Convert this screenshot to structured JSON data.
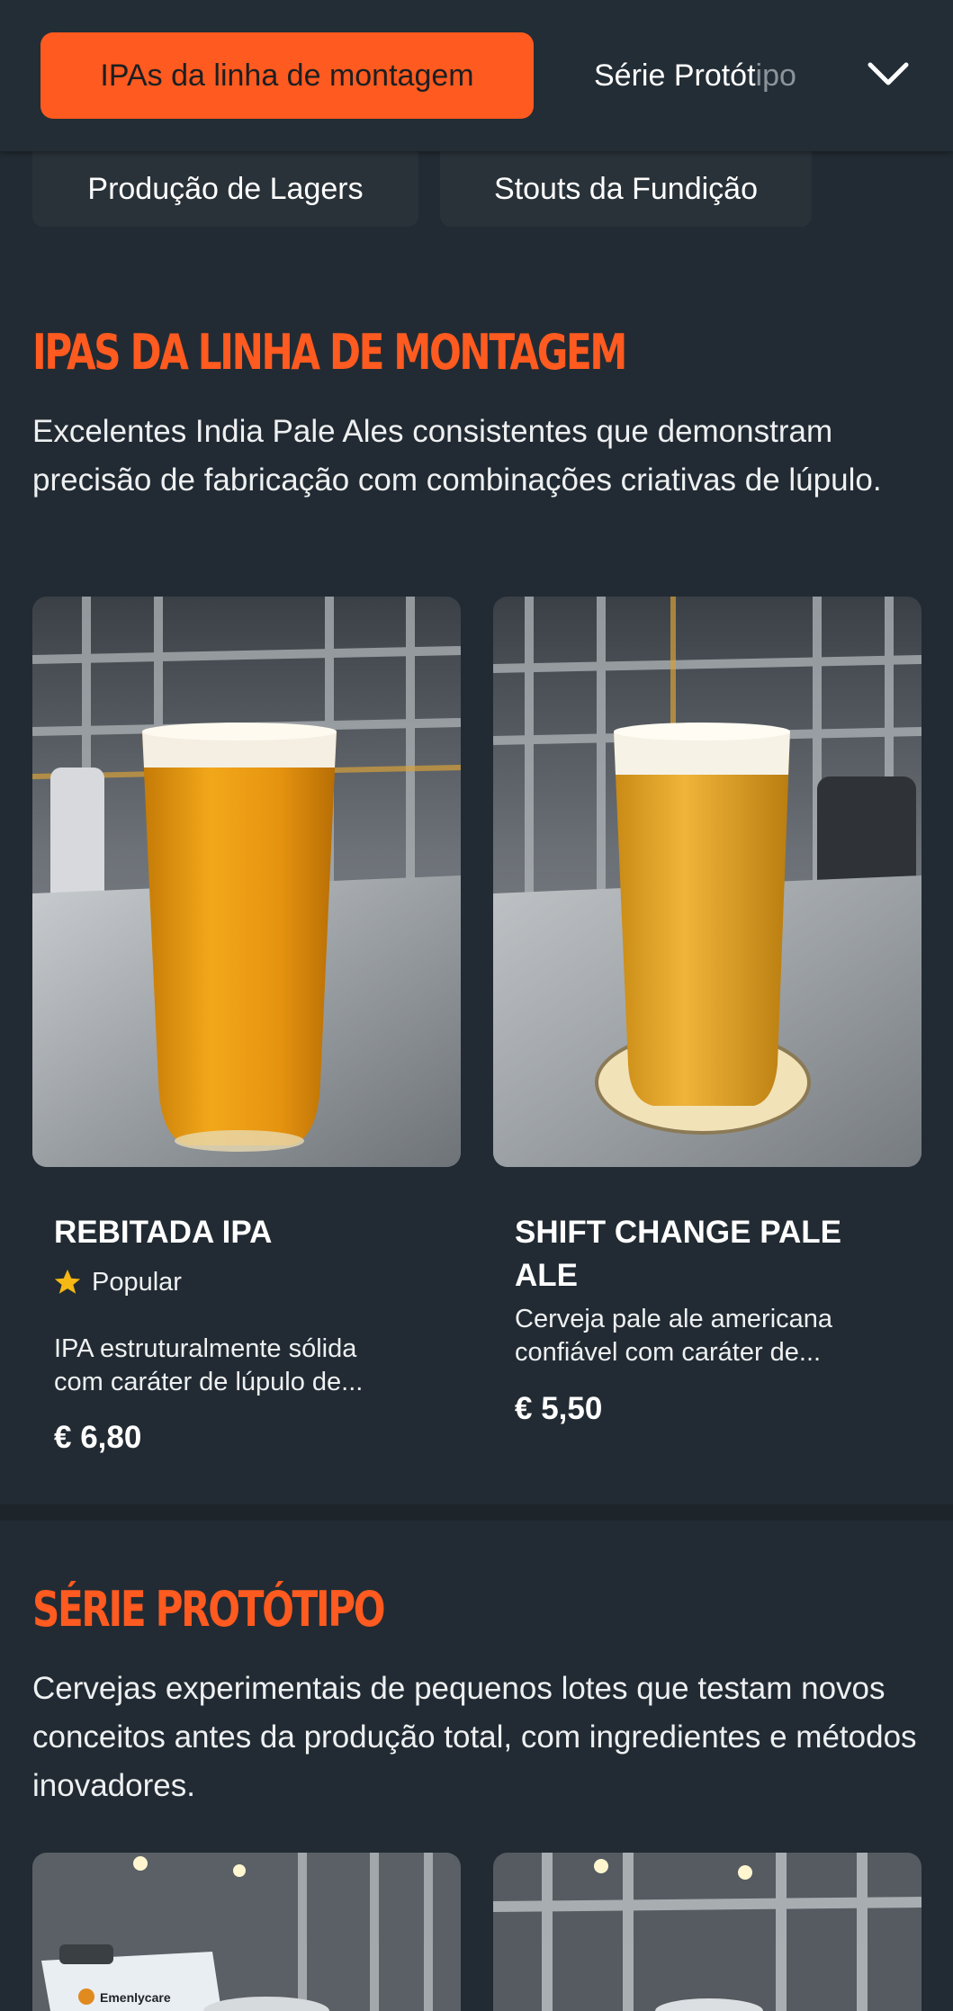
{
  "nav": {
    "active_tab": "IPAs da linha de montagem",
    "next_tab_visible": "Série Protót",
    "next_tab_faded": "ipo",
    "subtabs": [
      "Produção de Lagers",
      "Stouts da Fundição"
    ]
  },
  "sections": [
    {
      "title": "IPAs da linha de montagem",
      "description": "Excelentes India Pale Ales consistentes que demonstram precisão de fabricação com combinações criativas de lúpulo.",
      "products": [
        {
          "name": "REBITADA IPA",
          "badge": "Popular",
          "description_line1": "IPA estruturalmente sólida",
          "description_line2": "com caráter de lúpulo de...",
          "price": "€ 6,80"
        },
        {
          "name_line1": "SHIFT CHANGE PALE",
          "name_line2": "ALE",
          "description_line1": "Cerveja pale ale americana",
          "description_line2": "confiável com caráter de...",
          "price": "€ 5,50"
        }
      ]
    },
    {
      "title": "Série Protótipo",
      "description": "Cervejas experimentais de pequenos lotes que testam novos conceitos antes da produção total, com ingredientes e métodos inovadores.",
      "clipboard_text": "Emenlycare"
    }
  ],
  "colors": {
    "accent": "#ff5a1f",
    "background": "#222b33",
    "star": "#f5b814"
  }
}
